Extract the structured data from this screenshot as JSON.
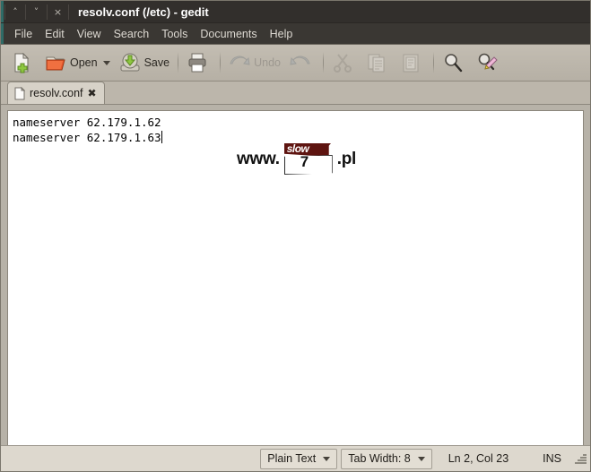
{
  "window": {
    "title": "resolv.conf (/etc) - gedit",
    "buttons": [
      {
        "name": "minimize",
        "glyph": "˄"
      },
      {
        "name": "maximize",
        "glyph": "˅"
      },
      {
        "name": "close",
        "glyph": "×"
      }
    ]
  },
  "menubar": {
    "items": [
      {
        "label": "File"
      },
      {
        "label": "Edit"
      },
      {
        "label": "View"
      },
      {
        "label": "Search"
      },
      {
        "label": "Tools"
      },
      {
        "label": "Documents"
      },
      {
        "label": "Help"
      }
    ]
  },
  "toolbar": {
    "new_label": "",
    "open_label": "Open",
    "save_label": "Save",
    "print_label": "",
    "undo_label": "Undo",
    "redo_label": "",
    "cut_label": "",
    "copy_label": "",
    "paste_label": "",
    "find_label": "",
    "replace_label": ""
  },
  "tabs": [
    {
      "title": "resolv.conf",
      "close": "✖",
      "active": true
    }
  ],
  "editor": {
    "line1": "nameserver 62.179.1.62",
    "line2": "nameserver 62.179.1.63",
    "watermark": {
      "prefix": "www.",
      "logo_word": "slow",
      "logo_number": "7",
      "suffix": ".pl"
    }
  },
  "statusbar": {
    "language": "Plain Text",
    "tab_width": "Tab Width: 8",
    "position": "Ln 2, Col 23",
    "insert_mode": "INS"
  },
  "colors": {
    "titlebar_bg": "#322f2c",
    "menubar_bg": "#3a3733",
    "accent_teal": "#2f6b66",
    "toolbar_bg": "#bcb6ab",
    "editor_bg": "#ffffff",
    "statusbar_bg": "#ddd8ce",
    "logo_maroon": "#5e1410"
  }
}
